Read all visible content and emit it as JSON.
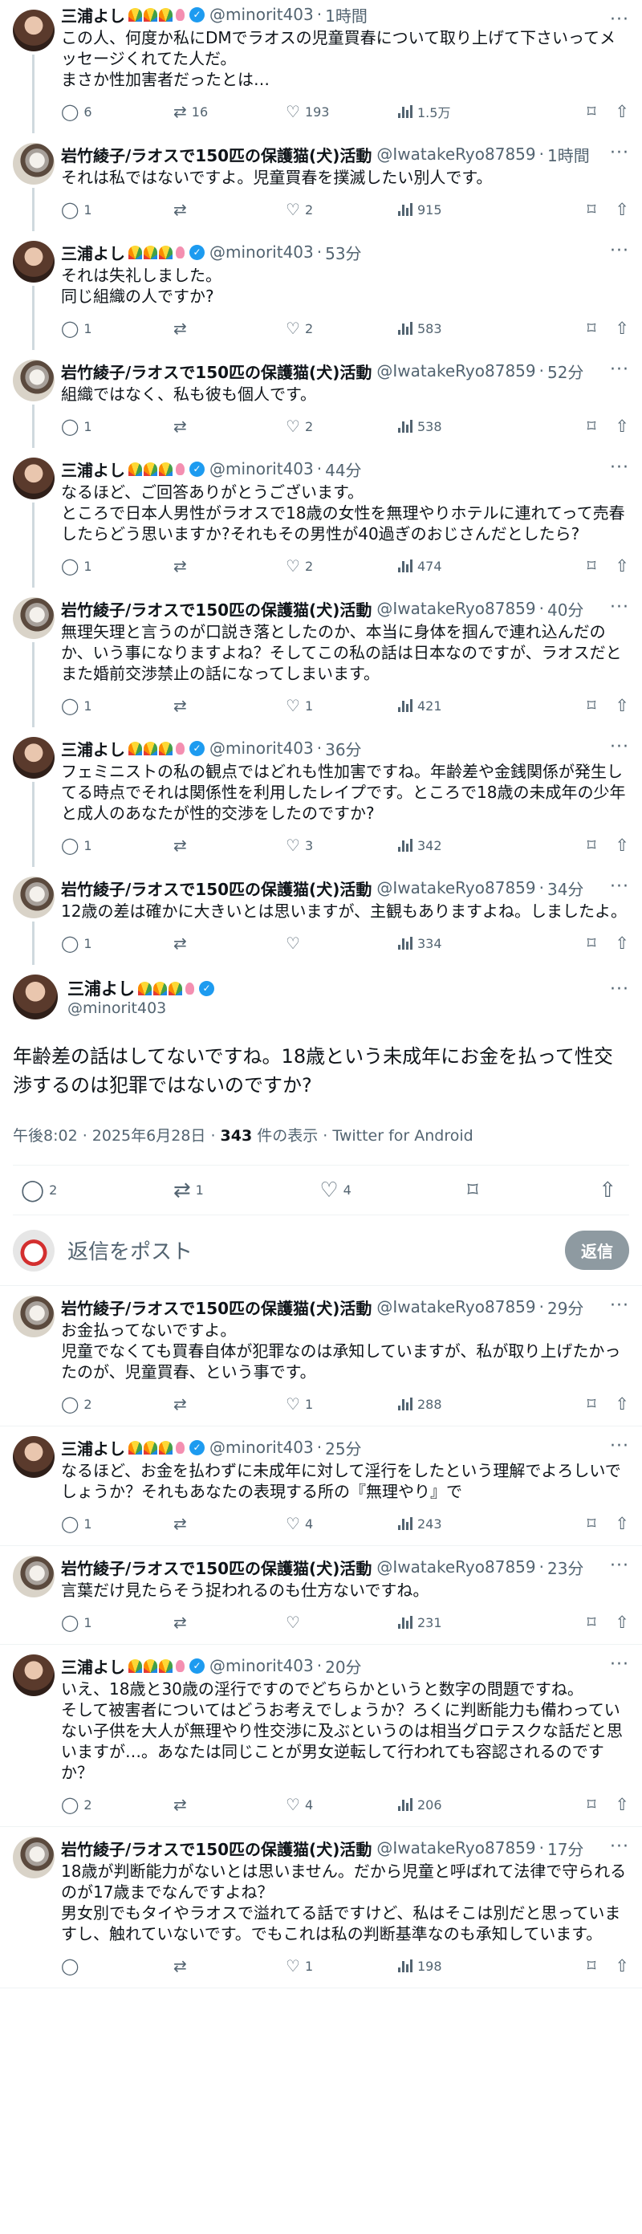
{
  "users": {
    "miura": {
      "name": "三浦よし",
      "handle": "@minorit403"
    },
    "iwatake": {
      "name": "岩竹綾子/ラオスで150匹の保護猫(犬)活動",
      "handle": "@IwatakeRyo87859"
    }
  },
  "separator": "·",
  "tweets_before": [
    {
      "user": "miura",
      "time": "1時間",
      "text": "この人、何度か私にDMでラオスの児童買春について取り上げて下さいってメッセージくれてた人だ。\nまさか性加害者だったとは…",
      "replies": "6",
      "retweets": "16",
      "likes": "193",
      "views": "1.5万"
    },
    {
      "user": "iwatake",
      "time": "1時間",
      "text": "それは私ではないですよ。児童買春を撲滅したい別人です。",
      "replies": "1",
      "retweets": "",
      "likes": "2",
      "views": "915"
    },
    {
      "user": "miura",
      "time": "53分",
      "text": "それは失礼しました。\n同じ組織の人ですか?",
      "replies": "1",
      "retweets": "",
      "likes": "2",
      "views": "583"
    },
    {
      "user": "iwatake",
      "time": "52分",
      "text": "組織ではなく、私も彼も個人です。",
      "replies": "1",
      "retweets": "",
      "likes": "2",
      "views": "538"
    },
    {
      "user": "miura",
      "time": "44分",
      "text": "なるほど、ご回答ありがとうございます。\nところで日本人男性がラオスで18歳の女性を無理やりホテルに連れてって売春したらどう思いますか?それもその男性が40過ぎのおじさんだとしたら?",
      "replies": "1",
      "retweets": "",
      "likes": "2",
      "views": "474"
    },
    {
      "user": "iwatake",
      "time": "40分",
      "text": "無理矢理と言うのが口説き落としたのか、本当に身体を掴んで連れ込んだのか、いう事になりますよね？そしてこの私の話は日本なのですが、ラオスだとまた婚前交渉禁止の話になってしまいます。",
      "replies": "1",
      "retweets": "",
      "likes": "1",
      "views": "421"
    },
    {
      "user": "miura",
      "time": "36分",
      "text": "フェミニストの私の観点ではどれも性加害ですね。年齢差や金銭関係が発生してる時点でそれは関係性を利用したレイプです。ところで18歳の未成年の少年と成人のあなたが性的交渉をしたのですか?",
      "replies": "1",
      "retweets": "",
      "likes": "3",
      "views": "342"
    },
    {
      "user": "iwatake",
      "time": "34分",
      "text": "12歳の差は確かに大きいとは思いますが、主観もありますよね。しましたよ。",
      "replies": "1",
      "retweets": "",
      "likes": "",
      "views": "334"
    }
  ],
  "main": {
    "user": "miura",
    "text": "年齢差の話はしてないですね。18歳という未成年にお金を払って性交渉するのは犯罪ではないのですか?",
    "time": "午後8:02 · 2025年6月28日 · ",
    "views_count": "343",
    "views_label": " 件の表示 · Twitter for Android",
    "replies": "2",
    "retweets": "1",
    "likes": "4"
  },
  "reply_bar": {
    "placeholder": "返信をポスト",
    "button": "返信"
  },
  "tweets_after": [
    {
      "user": "iwatake",
      "time": "29分",
      "text": "お金払ってないですよ。\n児童でなくても買春自体が犯罪なのは承知していますが、私が取り上げたかったのが、児童買春、という事です。",
      "replies": "2",
      "retweets": "",
      "likes": "1",
      "views": "288"
    },
    {
      "user": "miura",
      "time": "25分",
      "text": "なるほど、お金を払わずに未成年に対して淫行をしたという理解でよろしいでしょうか？それもあなたの表現する所の『無理やり』で",
      "replies": "1",
      "retweets": "",
      "likes": "4",
      "views": "243"
    },
    {
      "user": "iwatake",
      "time": "23分",
      "text": "言葉だけ見たらそう捉われるのも仕方ないですね。",
      "replies": "1",
      "retweets": "",
      "likes": "",
      "views": "231"
    },
    {
      "user": "miura",
      "time": "20分",
      "text": "いえ、18歳と30歳の淫行ですのでどちらかというと数字の問題ですね。\nそして被害者についてはどうお考えでしょうか？ろくに判断能力も備わっていない子供を大人が無理やり性交渉に及ぶというのは相当グロテスクな話だと思いますが…。あなたは同じことが男女逆転して行われても容認されるのですか？",
      "replies": "2",
      "retweets": "",
      "likes": "4",
      "views": "206"
    },
    {
      "user": "iwatake",
      "time": "17分",
      "text": "18歳が判断能力がないとは思いません。だから児童と呼ばれて法律で守られるのが17歳までなんですよね？\n男女別でもタイやラオスで溢れてる話ですけど、私はそこは別だと思っていますし、触れていないです。でもこれは私の判断基準なのも承知しています。",
      "replies": "",
      "retweets": "",
      "likes": "1",
      "views": "198"
    }
  ],
  "icons": {
    "reply": "reply-icon",
    "retweet": "retweet-icon",
    "like": "heart-icon",
    "views": "views-icon",
    "bookmark": "bookmark-icon",
    "share": "share-icon",
    "more": "more-icon",
    "verified": "verified-badge-icon"
  },
  "colors": {
    "accent": "#1d9bf0",
    "muted": "#536471",
    "text": "#0f1419",
    "thread": "#cfd9de"
  }
}
